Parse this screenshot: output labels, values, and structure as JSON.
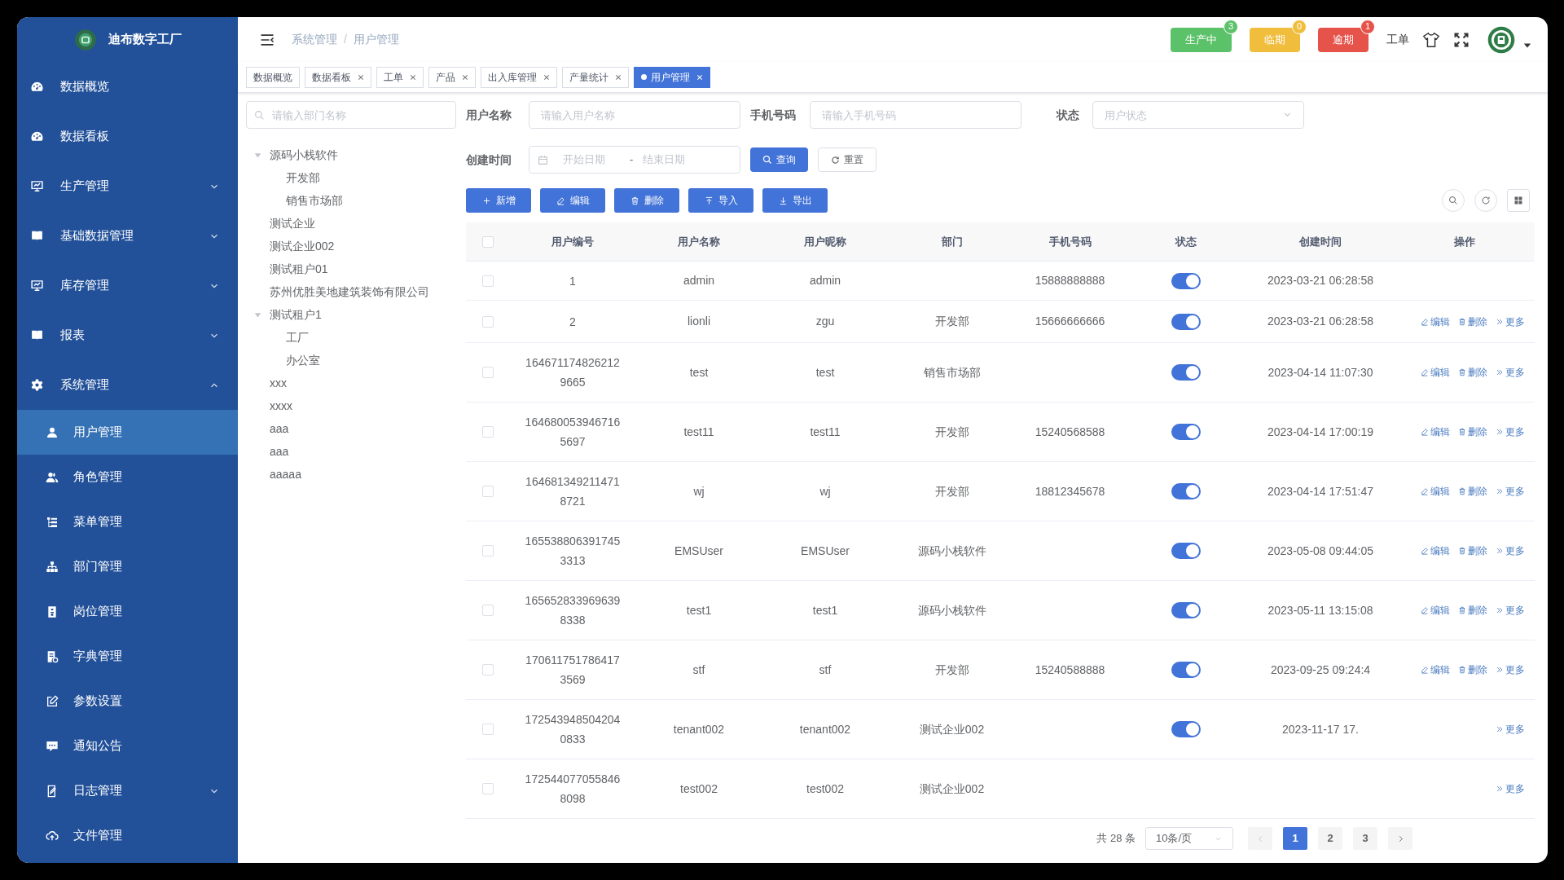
{
  "app": {
    "title": "迪布数字工厂"
  },
  "sidebar": {
    "items": [
      {
        "label": "数据概览"
      },
      {
        "label": "数据看板"
      },
      {
        "label": "生产管理",
        "expanded": false
      },
      {
        "label": "基础数据管理",
        "expanded": false
      },
      {
        "label": "库存管理",
        "expanded": false
      },
      {
        "label": "报表",
        "expanded": false
      },
      {
        "label": "系统管理",
        "expanded": true,
        "children": [
          {
            "label": "用户管理",
            "selected": true
          },
          {
            "label": "角色管理",
            "selected": false
          },
          {
            "label": "菜单管理",
            "selected": false
          },
          {
            "label": "部门管理",
            "selected": false
          },
          {
            "label": "岗位管理",
            "selected": false
          },
          {
            "label": "字典管理",
            "selected": false
          },
          {
            "label": "参数设置",
            "selected": false
          },
          {
            "label": "通知公告",
            "selected": false
          },
          {
            "label": "日志管理",
            "selected": false,
            "expanded": false
          },
          {
            "label": "文件管理",
            "selected": false
          }
        ]
      }
    ]
  },
  "breadcrumb": {
    "items": [
      "系统管理",
      "用户管理"
    ],
    "separator": "/"
  },
  "header": {
    "status_buttons": [
      {
        "label": "生产中",
        "count": "3",
        "color": "#5cc26a"
      },
      {
        "label": "临期",
        "count": "0",
        "color": "#f0bd3d"
      },
      {
        "label": "逾期",
        "count": "1",
        "color": "#e5534b"
      }
    ],
    "work_order": "工单"
  },
  "tabs": [
    {
      "label": "数据概览",
      "closable": false,
      "selected": false
    },
    {
      "label": "数据看板",
      "closable": true,
      "selected": false
    },
    {
      "label": "工单",
      "closable": true,
      "selected": false
    },
    {
      "label": "产品",
      "closable": true,
      "selected": false
    },
    {
      "label": "出入库管理",
      "closable": true,
      "selected": false
    },
    {
      "label": "产量统计",
      "closable": true,
      "selected": false
    },
    {
      "label": "用户管理",
      "closable": true,
      "selected": true
    }
  ],
  "dept_tree": {
    "search": {
      "placeholder": "请输入部门名称"
    },
    "nodes": [
      {
        "label": "源码小栈软件",
        "expanded": true,
        "children": [
          {
            "label": "开发部"
          },
          {
            "label": "销售市场部"
          }
        ]
      },
      {
        "label": "测试企业"
      },
      {
        "label": "测试企业002"
      },
      {
        "label": "测试租户01"
      },
      {
        "label": "苏州优胜美地建筑装饰有限公司"
      },
      {
        "label": "测试租户1",
        "expanded": true,
        "children": [
          {
            "label": "工厂"
          },
          {
            "label": "办公室"
          }
        ]
      },
      {
        "label": "xxx"
      },
      {
        "label": "xxxx"
      },
      {
        "label": "aaa"
      },
      {
        "label": "aaa"
      },
      {
        "label": "aaaaa"
      }
    ]
  },
  "filters": {
    "user_name": {
      "label": "用户名称",
      "placeholder": "请输入用户名称"
    },
    "phone": {
      "label": "手机号码",
      "placeholder": "请输入手机号码"
    },
    "status": {
      "label": "状态",
      "placeholder": "用户状态"
    },
    "created": {
      "label": "创建时间",
      "start_placeholder": "开始日期",
      "separator": "-",
      "end_placeholder": "结束日期"
    },
    "search_button": "查询",
    "reset_button": "重置"
  },
  "toolbar": [
    {
      "kind": "add",
      "label": "新增"
    },
    {
      "kind": "edit",
      "label": "编辑"
    },
    {
      "kind": "delete",
      "label": "删除"
    },
    {
      "kind": "import",
      "label": "导入"
    },
    {
      "kind": "export",
      "label": "导出"
    }
  ],
  "table": {
    "header_checked": false,
    "columns": [
      "用户编号",
      "用户名称",
      "用户昵称",
      "部门",
      "手机号码",
      "状态",
      "创建时间",
      "操作"
    ],
    "rows": [
      {
        "checked": false,
        "id": "1",
        "name": "admin",
        "nickname": "admin",
        "phone": "15888888888",
        "on": true,
        "created": "2023-03-21 06:28:58"
      },
      {
        "checked": false,
        "id": "2",
        "name": "lionli",
        "nickname": "zgu",
        "dept": "开发部",
        "phone": "15666666666",
        "on": true,
        "created": "2023-03-21 06:28:58",
        "actions": [
          {
            "kind": "edit",
            "label": "编辑"
          },
          {
            "kind": "delete",
            "label": "删除"
          },
          {
            "kind": "more",
            "label": "更多"
          }
        ]
      },
      {
        "checked": false,
        "id": "1646711748262129665",
        "name": "test",
        "nickname": "test",
        "dept": "销售市场部",
        "on": true,
        "created": "2023-04-14 11:07:30",
        "actions": [
          {
            "kind": "edit",
            "label": "编辑"
          },
          {
            "kind": "delete",
            "label": "删除"
          },
          {
            "kind": "more",
            "label": "更多"
          }
        ]
      },
      {
        "checked": false,
        "id": "1646800539467165697",
        "name": "test11",
        "nickname": "test11",
        "dept": "开发部",
        "phone": "15240568588",
        "on": true,
        "created": "2023-04-14 17:00:19",
        "actions": [
          {
            "kind": "edit",
            "label": "编辑"
          },
          {
            "kind": "delete",
            "label": "删除"
          },
          {
            "kind": "more",
            "label": "更多"
          }
        ]
      },
      {
        "checked": false,
        "id": "1646813492114718721",
        "name": "wj",
        "nickname": "wj",
        "dept": "开发部",
        "phone": "18812345678",
        "on": true,
        "created": "2023-04-14 17:51:47",
        "actions": [
          {
            "kind": "edit",
            "label": "编辑"
          },
          {
            "kind": "delete",
            "label": "删除"
          },
          {
            "kind": "more",
            "label": "更多"
          }
        ]
      },
      {
        "checked": false,
        "id": "1655388063917453313",
        "name": "EMSUser",
        "nickname": "EMSUser",
        "dept": "源码小栈软件",
        "on": true,
        "created": "2023-05-08 09:44:05",
        "actions": [
          {
            "kind": "edit",
            "label": "编辑"
          },
          {
            "kind": "delete",
            "label": "删除"
          },
          {
            "kind": "more",
            "label": "更多"
          }
        ]
      },
      {
        "checked": false,
        "id": "1656528339696398338",
        "name": "test1",
        "nickname": "test1",
        "dept": "源码小栈软件",
        "on": true,
        "created": "2023-05-11 13:15:08",
        "actions": [
          {
            "kind": "edit",
            "label": "编辑"
          },
          {
            "kind": "delete",
            "label": "删除"
          },
          {
            "kind": "more",
            "label": "更多"
          }
        ]
      },
      {
        "checked": false,
        "id": "1706117517864173569",
        "name": "stf",
        "nickname": "stf",
        "dept": "开发部",
        "phone": "15240588888",
        "on": true,
        "created": "2023-09-25 09:24:4",
        "actions": [
          {
            "kind": "edit",
            "label": "编辑"
          },
          {
            "kind": "delete",
            "label": "删除"
          },
          {
            "kind": "more",
            "label": "更多"
          }
        ]
      },
      {
        "checked": false,
        "id": "1725439485042040833",
        "name": "tenant002",
        "nickname": "tenant002",
        "dept": "测试企业002",
        "on": true,
        "created": "2023-11-17 17.",
        "actions": [
          {
            "kind": "more",
            "label": "更多"
          }
        ]
      },
      {
        "checked": false,
        "id": "1725440770558468098",
        "name": "test002",
        "nickname": "test002",
        "dept": "测试企业002",
        "actions": [
          {
            "kind": "more",
            "label": "更多"
          }
        ]
      }
    ]
  },
  "pagination": {
    "total": "共 28 条",
    "page_size": "10条/页",
    "pages": [
      {
        "label": "1",
        "selected": true
      },
      {
        "label": "2",
        "selected": false
      },
      {
        "label": "3",
        "selected": false
      }
    ]
  }
}
